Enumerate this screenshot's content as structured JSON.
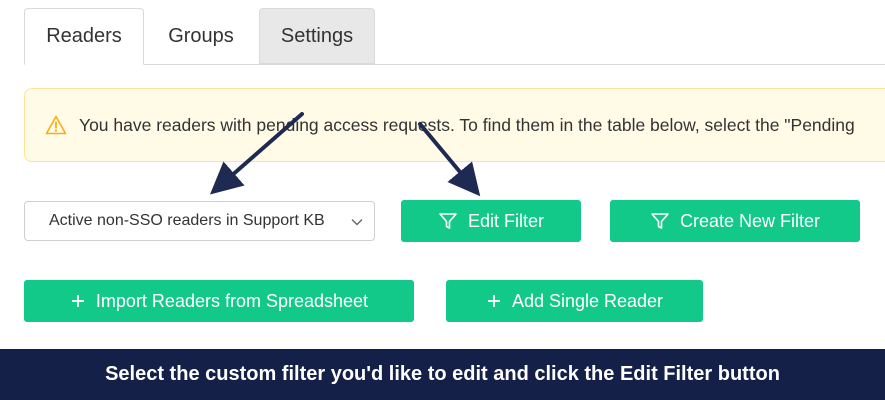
{
  "tabs": {
    "readers": "Readers",
    "groups": "Groups",
    "settings": "Settings"
  },
  "alert": {
    "icon": "warning-icon",
    "text": "You have readers with pending access requests. To find them in the table below, select the \"Pending"
  },
  "filter_select": {
    "value": "Active non-SSO readers in Support KB",
    "icon": "chevron-down-icon"
  },
  "buttons": {
    "edit_filter": "Edit Filter",
    "create_new_filter": "Create New Filter",
    "import_readers": "Import Readers from Spreadsheet",
    "add_single_reader": "Add Single Reader"
  },
  "caption": "Select the custom filter you'd like to edit and click the Edit Filter button",
  "colors": {
    "accent": "#13c98a",
    "caption_bg": "#152048",
    "alert_bg": "#fffbe6",
    "alert_border": "#ffe58f",
    "warning": "#faad14",
    "arrow": "#1e2a52"
  }
}
